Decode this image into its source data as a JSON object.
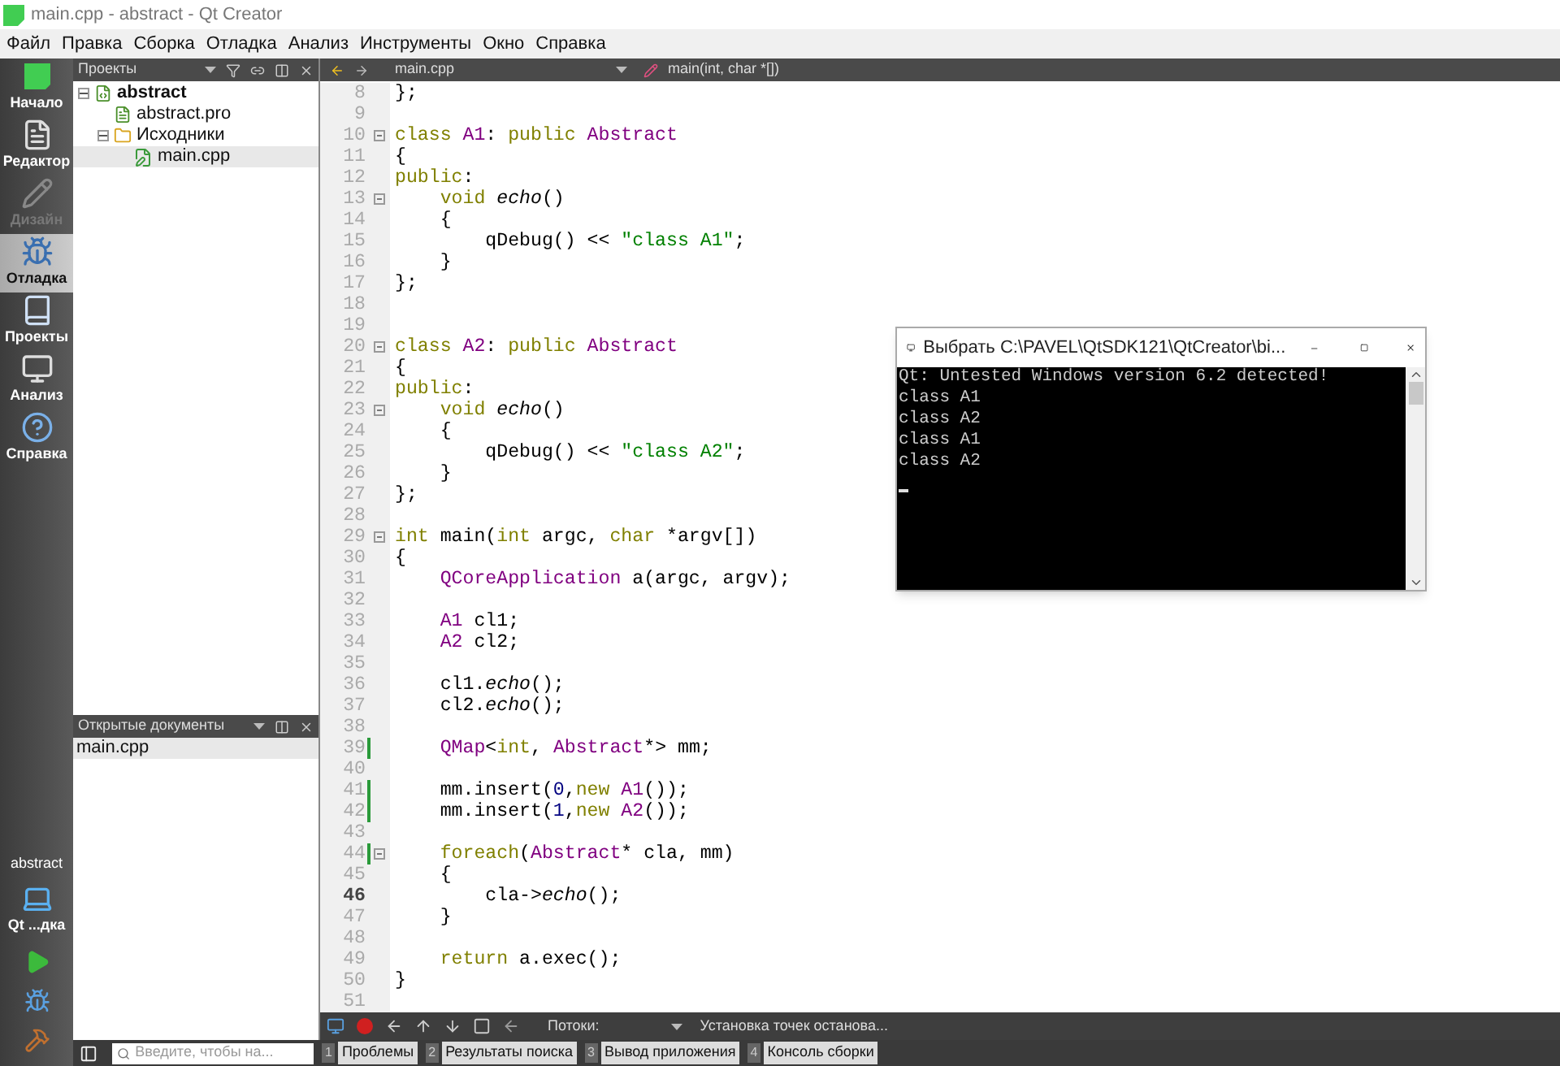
{
  "window": {
    "title": "main.cpp - abstract - Qt Creator"
  },
  "menu": [
    "Файл",
    "Правка",
    "Сборка",
    "Отладка",
    "Анализ",
    "Инструменты",
    "Окно",
    "Справка"
  ],
  "modes": [
    {
      "label": "Начало",
      "kind": "welcome",
      "selected": false,
      "disabled": false
    },
    {
      "label": "Редактор",
      "kind": "edit",
      "selected": false,
      "disabled": false
    },
    {
      "label": "Дизайн",
      "kind": "design",
      "selected": false,
      "disabled": true
    },
    {
      "label": "Отладка",
      "kind": "debug",
      "selected": true,
      "disabled": false
    },
    {
      "label": "Проекты",
      "kind": "projects",
      "selected": false,
      "disabled": false
    },
    {
      "label": "Анализ",
      "kind": "analyze",
      "selected": false,
      "disabled": false
    },
    {
      "label": "Справка",
      "kind": "help",
      "selected": false,
      "disabled": false
    }
  ],
  "target": {
    "project": "abstract",
    "kit": "Qt ...дка"
  },
  "projects_panel": {
    "title": "Проекты",
    "tree": [
      {
        "label": "abstract",
        "kind": "project",
        "expanded": true,
        "selected": false,
        "children": [
          {
            "label": "abstract.pro",
            "kind": "pro",
            "selected": false
          },
          {
            "label": "Исходники",
            "kind": "folder",
            "expanded": true,
            "selected": false,
            "children": [
              {
                "label": "main.cpp",
                "kind": "cpp",
                "selected": true
              }
            ]
          }
        ]
      }
    ]
  },
  "open_documents": {
    "title": "Открытые документы",
    "items": [
      {
        "label": "main.cpp",
        "selected": true
      }
    ]
  },
  "editor": {
    "file": "main.cpp",
    "function": "main(int, char *[])",
    "lines": [
      {
        "number": "8",
        "fold": false,
        "changed": false,
        "current": false,
        "tokens": [
          {
            "kind": "plain",
            "text": "};"
          }
        ]
      },
      {
        "number": "9",
        "fold": false,
        "changed": false,
        "current": false
      },
      {
        "number": "10",
        "fold": true,
        "changed": false,
        "current": false,
        "tokens": [
          {
            "kind": "keyword",
            "text": "class"
          },
          {
            "kind": "type",
            "text": " A1"
          },
          {
            "kind": "plain",
            "text": ":"
          },
          {
            "kind": "keyword",
            "text": " public"
          },
          {
            "kind": "type",
            "text": " Abstract"
          }
        ]
      },
      {
        "number": "11",
        "fold": false,
        "changed": false,
        "current": false,
        "tokens": [
          {
            "kind": "plain",
            "text": "{"
          }
        ]
      },
      {
        "number": "12",
        "fold": false,
        "changed": false,
        "current": false,
        "tokens": [
          {
            "kind": "keyword",
            "text": "public"
          },
          {
            "kind": "plain",
            "text": ":"
          }
        ]
      },
      {
        "number": "13",
        "fold": true,
        "changed": false,
        "current": false,
        "tokens": [
          {
            "kind": "keyword",
            "text": "    void"
          },
          {
            "kind": "function",
            "text": " echo"
          },
          {
            "kind": "plain",
            "text": "()"
          }
        ]
      },
      {
        "number": "14",
        "fold": false,
        "changed": false,
        "current": false,
        "tokens": [
          {
            "kind": "plain",
            "text": "    {"
          }
        ]
      },
      {
        "number": "15",
        "fold": false,
        "changed": false,
        "current": false,
        "tokens": [
          {
            "kind": "plain",
            "text": "        qDebug() << "
          },
          {
            "kind": "string",
            "text": "\"class A1\""
          },
          {
            "kind": "plain",
            "text": ";"
          }
        ]
      },
      {
        "number": "16",
        "fold": false,
        "changed": false,
        "current": false,
        "tokens": [
          {
            "kind": "plain",
            "text": "    }"
          }
        ]
      },
      {
        "number": "17",
        "fold": false,
        "changed": false,
        "current": false,
        "tokens": [
          {
            "kind": "plain",
            "text": "};"
          }
        ]
      },
      {
        "number": "18",
        "fold": false,
        "changed": false,
        "current": false
      },
      {
        "number": "19",
        "fold": false,
        "changed": false,
        "current": false
      },
      {
        "number": "20",
        "fold": true,
        "changed": false,
        "current": false,
        "tokens": [
          {
            "kind": "keyword",
            "text": "class"
          },
          {
            "kind": "type",
            "text": " A2"
          },
          {
            "kind": "plain",
            "text": ":"
          },
          {
            "kind": "keyword",
            "text": " public"
          },
          {
            "kind": "type",
            "text": " Abstract"
          }
        ]
      },
      {
        "number": "21",
        "fold": false,
        "changed": false,
        "current": false,
        "tokens": [
          {
            "kind": "plain",
            "text": "{"
          }
        ]
      },
      {
        "number": "22",
        "fold": false,
        "changed": false,
        "current": false,
        "tokens": [
          {
            "kind": "keyword",
            "text": "public"
          },
          {
            "kind": "plain",
            "text": ":"
          }
        ]
      },
      {
        "number": "23",
        "fold": true,
        "changed": false,
        "current": false,
        "tokens": [
          {
            "kind": "keyword",
            "text": "    void"
          },
          {
            "kind": "function",
            "text": " echo"
          },
          {
            "kind": "plain",
            "text": "()"
          }
        ]
      },
      {
        "number": "24",
        "fold": false,
        "changed": false,
        "current": false,
        "tokens": [
          {
            "kind": "plain",
            "text": "    {"
          }
        ]
      },
      {
        "number": "25",
        "fold": false,
        "changed": false,
        "current": false,
        "tokens": [
          {
            "kind": "plain",
            "text": "        qDebug() << "
          },
          {
            "kind": "string",
            "text": "\"class A2\""
          },
          {
            "kind": "plain",
            "text": ";"
          }
        ]
      },
      {
        "number": "26",
        "fold": false,
        "changed": false,
        "current": false,
        "tokens": [
          {
            "kind": "plain",
            "text": "    }"
          }
        ]
      },
      {
        "number": "27",
        "fold": false,
        "changed": false,
        "current": false,
        "tokens": [
          {
            "kind": "plain",
            "text": "};"
          }
        ]
      },
      {
        "number": "28",
        "fold": false,
        "changed": false,
        "current": false
      },
      {
        "number": "29",
        "fold": true,
        "changed": false,
        "current": false,
        "tokens": [
          {
            "kind": "keyword",
            "text": "int"
          },
          {
            "kind": "plain",
            "text": " main("
          },
          {
            "kind": "keyword",
            "text": "int"
          },
          {
            "kind": "plain",
            "text": " argc, "
          },
          {
            "kind": "keyword",
            "text": "char"
          },
          {
            "kind": "plain",
            "text": " *argv[])"
          }
        ]
      },
      {
        "number": "30",
        "fold": false,
        "changed": false,
        "current": false,
        "tokens": [
          {
            "kind": "plain",
            "text": "{"
          }
        ]
      },
      {
        "number": "31",
        "fold": false,
        "changed": false,
        "current": false,
        "tokens": [
          {
            "kind": "type",
            "text": "    QCoreApplication"
          },
          {
            "kind": "plain",
            "text": " a(argc, argv);"
          }
        ]
      },
      {
        "number": "32",
        "fold": false,
        "changed": false,
        "current": false
      },
      {
        "number": "33",
        "fold": false,
        "changed": false,
        "current": false,
        "tokens": [
          {
            "kind": "type",
            "text": "    A1"
          },
          {
            "kind": "plain",
            "text": " cl1;"
          }
        ]
      },
      {
        "number": "34",
        "fold": false,
        "changed": false,
        "current": false,
        "tokens": [
          {
            "kind": "type",
            "text": "    A2"
          },
          {
            "kind": "plain",
            "text": " cl2;"
          }
        ]
      },
      {
        "number": "35",
        "fold": false,
        "changed": false,
        "current": false
      },
      {
        "number": "36",
        "fold": false,
        "changed": false,
        "current": false,
        "tokens": [
          {
            "kind": "plain",
            "text": "    cl1."
          },
          {
            "kind": "function",
            "text": "echo"
          },
          {
            "kind": "plain",
            "text": "();"
          }
        ]
      },
      {
        "number": "37",
        "fold": false,
        "changed": false,
        "current": false,
        "tokens": [
          {
            "kind": "plain",
            "text": "    cl2."
          },
          {
            "kind": "function",
            "text": "echo"
          },
          {
            "kind": "plain",
            "text": "();"
          }
        ]
      },
      {
        "number": "38",
        "fold": false,
        "changed": false,
        "current": false
      },
      {
        "number": "39",
        "fold": false,
        "changed": true,
        "current": false,
        "tokens": [
          {
            "kind": "type",
            "text": "    QMap"
          },
          {
            "kind": "plain",
            "text": "<"
          },
          {
            "kind": "keyword",
            "text": "int"
          },
          {
            "kind": "plain",
            "text": ", "
          },
          {
            "kind": "type",
            "text": "Abstract"
          },
          {
            "kind": "plain",
            "text": "*> mm;"
          }
        ]
      },
      {
        "number": "40",
        "fold": false,
        "changed": false,
        "current": false
      },
      {
        "number": "41",
        "fold": false,
        "changed": true,
        "current": false,
        "tokens": [
          {
            "kind": "plain",
            "text": "    mm.insert("
          },
          {
            "kind": "number",
            "text": "0"
          },
          {
            "kind": "plain",
            "text": ","
          },
          {
            "kind": "keyword",
            "text": "new"
          },
          {
            "kind": "type",
            "text": " A1"
          },
          {
            "kind": "plain",
            "text": "());"
          }
        ]
      },
      {
        "number": "42",
        "fold": false,
        "changed": true,
        "current": false,
        "tokens": [
          {
            "kind": "plain",
            "text": "    mm.insert("
          },
          {
            "kind": "number",
            "text": "1"
          },
          {
            "kind": "plain",
            "text": ","
          },
          {
            "kind": "keyword",
            "text": "new"
          },
          {
            "kind": "type",
            "text": " A2"
          },
          {
            "kind": "plain",
            "text": "());"
          }
        ]
      },
      {
        "number": "43",
        "fold": false,
        "changed": false,
        "current": false
      },
      {
        "number": "44",
        "fold": true,
        "changed": true,
        "current": false,
        "tokens": [
          {
            "kind": "keyword",
            "text": "    foreach"
          },
          {
            "kind": "plain",
            "text": "("
          },
          {
            "kind": "type",
            "text": "Abstract"
          },
          {
            "kind": "plain",
            "text": "* cla, mm)"
          }
        ]
      },
      {
        "number": "45",
        "fold": false,
        "changed": false,
        "current": false,
        "tokens": [
          {
            "kind": "plain",
            "text": "    {"
          }
        ]
      },
      {
        "number": "46",
        "fold": false,
        "changed": false,
        "current": true,
        "tokens": [
          {
            "kind": "plain",
            "text": "        cla->"
          },
          {
            "kind": "function",
            "text": "echo"
          },
          {
            "kind": "plain",
            "text": "();"
          }
        ]
      },
      {
        "number": "47",
        "fold": false,
        "changed": false,
        "current": false,
        "tokens": [
          {
            "kind": "plain",
            "text": "    }"
          }
        ]
      },
      {
        "number": "48",
        "fold": false,
        "changed": false,
        "current": false
      },
      {
        "number": "49",
        "fold": false,
        "changed": false,
        "current": false,
        "tokens": [
          {
            "kind": "keyword",
            "text": "    return"
          },
          {
            "kind": "plain",
            "text": " a.exec();"
          }
        ]
      },
      {
        "number": "50",
        "fold": false,
        "changed": false,
        "current": false,
        "tokens": [
          {
            "kind": "plain",
            "text": "}"
          }
        ]
      },
      {
        "number": "51",
        "fold": false,
        "changed": false,
        "current": false
      }
    ]
  },
  "debug_toolbar": {
    "threads_label": "Потоки:",
    "status": "Установка точек останова..."
  },
  "locator": {
    "placeholder": "Введите, чтобы на..."
  },
  "output_tabs": [
    {
      "number": "1",
      "label": "Проблемы"
    },
    {
      "number": "2",
      "label": "Результаты поиска"
    },
    {
      "number": "3",
      "label": "Вывод приложения"
    },
    {
      "number": "4",
      "label": "Консоль сборки"
    }
  ],
  "console": {
    "title": "Выбрать C:\\PAVEL\\QtSDK121\\QtCreator\\bi...",
    "lines": [
      "Qt: Untested Windows version 6.2 detected!",
      "class A1",
      "class A2",
      "class A1",
      "class A2"
    ]
  }
}
